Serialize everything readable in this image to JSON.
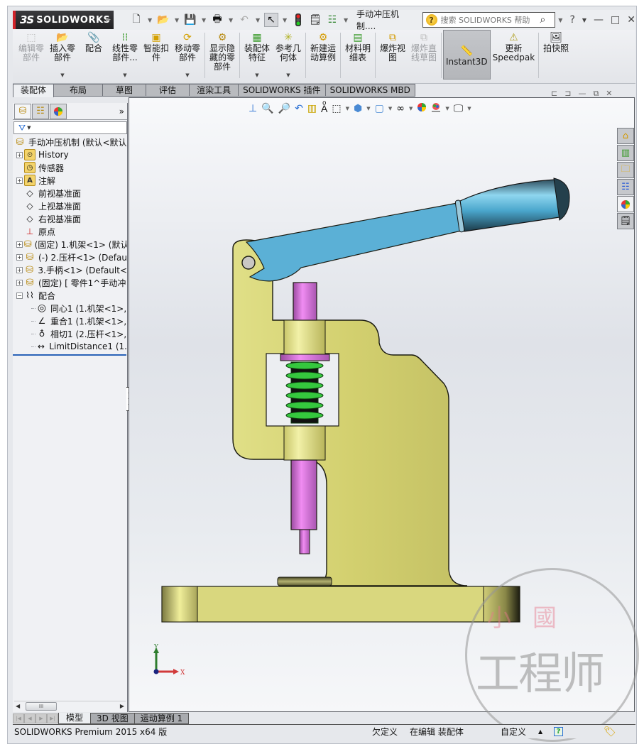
{
  "app": {
    "logo_prefix": "3S",
    "logo_text": "SOLIDWORKS",
    "document_title": "手动冲压机制....",
    "search_placeholder": "搜索 SOLIDWORKS 帮助",
    "help_glyph": "?",
    "window_controls": [
      "?",
      "—",
      "□",
      "✕"
    ]
  },
  "quick_access": [
    {
      "name": "new",
      "icon": "new-document-icon"
    },
    {
      "name": "open",
      "icon": "open-folder-icon"
    },
    {
      "name": "save",
      "icon": "save-icon"
    },
    {
      "name": "print",
      "icon": "print-icon"
    },
    {
      "name": "undo",
      "icon": "undo-icon"
    },
    {
      "name": "select",
      "icon": "select-pointer-icon"
    },
    {
      "name": "rebuild",
      "icon": "traffic-light-icon"
    },
    {
      "name": "file-properties",
      "icon": "file-properties-icon"
    },
    {
      "name": "options",
      "icon": "options-icon"
    }
  ],
  "ribbon": {
    "buttons": [
      {
        "label": "编辑零\n部件",
        "icon": "edit-component-icon",
        "disabled": true,
        "dropdown": false
      },
      {
        "label": "插入零\n部件",
        "icon": "insert-component-icon",
        "disabled": false,
        "dropdown": true
      },
      {
        "label": "配合",
        "icon": "mate-paperclip-icon",
        "disabled": false,
        "dropdown": false
      },
      {
        "label": "线性零\n部件...",
        "icon": "linear-pattern-icon",
        "disabled": false,
        "dropdown": true
      },
      {
        "label": "智能扣\n件",
        "icon": "smart-fastener-icon",
        "disabled": false,
        "dropdown": false
      },
      {
        "label": "移动零\n部件",
        "icon": "move-component-icon",
        "disabled": false,
        "dropdown": true
      },
      {
        "label": "显示隐\n藏的零\n部件",
        "icon": "show-hidden-icon",
        "disabled": false,
        "dropdown": false
      },
      {
        "label": "装配体\n特征",
        "icon": "assembly-feature-icon",
        "disabled": false,
        "dropdown": true
      },
      {
        "label": "参考几\n何体",
        "icon": "reference-geometry-icon",
        "disabled": false,
        "dropdown": true
      },
      {
        "label": "新建运\n动算例",
        "icon": "new-motion-study-icon",
        "disabled": false,
        "dropdown": false
      },
      {
        "label": "材料明\n细表",
        "icon": "bom-icon",
        "disabled": false,
        "dropdown": false
      },
      {
        "label": "爆炸视\n图",
        "icon": "exploded-view-icon",
        "disabled": false,
        "dropdown": false
      },
      {
        "label": "爆炸直\n线草图",
        "icon": "explode-line-sketch-icon",
        "disabled": true,
        "dropdown": false
      },
      {
        "label": "Instant3D",
        "icon": "instant3d-icon",
        "disabled": false,
        "dropdown": false,
        "active": true
      },
      {
        "label": "更新\nSpeedpak",
        "icon": "speedpak-icon",
        "disabled": false,
        "dropdown": false
      },
      {
        "label": "拍快照",
        "icon": "snapshot-icon",
        "disabled": false,
        "dropdown": false
      }
    ]
  },
  "command_tabs": [
    {
      "label": "装配体",
      "active": true
    },
    {
      "label": "布局"
    },
    {
      "label": "草图"
    },
    {
      "label": "评估"
    },
    {
      "label": "渲染工具"
    },
    {
      "label": "SOLIDWORKS 插件"
    },
    {
      "label": "SOLIDWORKS MBD"
    }
  ],
  "feature_manager": {
    "tabs": [
      "feature-manager-icon",
      "property-manager-icon",
      "appearance-manager-icon"
    ],
    "more": "»",
    "filter_icon": "▼",
    "tree": [
      {
        "level": 0,
        "expander": "",
        "icon": "assembly-icon",
        "label": "手动冲压机制  (默认<默认"
      },
      {
        "level": 1,
        "expander": "+",
        "icon": "history-icon",
        "label": "History"
      },
      {
        "level": 1,
        "expander": "",
        "icon": "sensor-icon",
        "label": "传感器"
      },
      {
        "level": 1,
        "expander": "+",
        "icon": "annotation-icon",
        "label": "注解"
      },
      {
        "level": 1,
        "expander": "",
        "icon": "plane-icon",
        "label": "前视基准面"
      },
      {
        "level": 1,
        "expander": "",
        "icon": "plane-icon",
        "label": "上视基准面"
      },
      {
        "level": 1,
        "expander": "",
        "icon": "plane-icon",
        "label": "右视基准面"
      },
      {
        "level": 1,
        "expander": "",
        "icon": "origin-icon",
        "label": "原点"
      },
      {
        "level": 1,
        "expander": "+",
        "icon": "part-icon",
        "label": "(固定) 1.机架<1> (默认"
      },
      {
        "level": 1,
        "expander": "+",
        "icon": "part-icon",
        "label": "(-) 2.压杆<1> (Defau"
      },
      {
        "level": 1,
        "expander": "+",
        "icon": "part-icon",
        "label": "3.手柄<1> (Default<"
      },
      {
        "level": 1,
        "expander": "+",
        "icon": "part-icon",
        "label": "(固定) [ 零件1^手动冲"
      },
      {
        "level": 1,
        "expander": "−",
        "icon": "mates-icon",
        "label": "配合"
      },
      {
        "level": 2,
        "expander": "",
        "icon": "concentric-icon",
        "label": "同心1 (1.机架<1>,"
      },
      {
        "level": 2,
        "expander": "",
        "icon": "coincident-icon",
        "label": "重合1 (1.机架<1>,"
      },
      {
        "level": 2,
        "expander": "",
        "icon": "tangent-icon",
        "label": "相切1 (2.压杆<1>,"
      },
      {
        "level": 2,
        "expander": "",
        "icon": "limit-distance-icon",
        "label": "LimitDistance1 (1."
      }
    ]
  },
  "view_toolbar": [
    "view-normal-icon",
    "zoom-to-fit-icon",
    "zoom-area-icon",
    "previous-view-icon",
    "section-view-icon",
    "dynamic-annotation-icon",
    "view-orientation-icon",
    "display-style-icon",
    "hide-show-items-icon",
    "edit-appearance-icon",
    "apply-scene-icon",
    "view-settings-icon"
  ],
  "viewport_controls": [
    "split-left-icon",
    "split-right-icon",
    "minimize-icon",
    "restore-icon",
    "close-icon"
  ],
  "task_pane": [
    {
      "icon": "solidworks-resources-icon"
    },
    {
      "icon": "design-library-icon"
    },
    {
      "icon": "file-explorer-icon"
    },
    {
      "icon": "view-palette-icon"
    },
    {
      "icon": "appearances-scenes-icon",
      "active": true
    },
    {
      "icon": "custom-properties-icon"
    }
  ],
  "triad": {
    "y_label": "Y",
    "x_label": "X"
  },
  "bottom_tabs": [
    {
      "label": "模型",
      "active": true
    },
    {
      "label": "3D 视图"
    },
    {
      "label": "运动算例 1"
    }
  ],
  "status": {
    "app_version": "SOLIDWORKS Premium 2015 x64 版",
    "definition": "欠定义",
    "mode": "在编辑 装配体",
    "units": "自定义",
    "up_arrow": "▲",
    "help": "?"
  },
  "watermark": {
    "top": "小國",
    "bottom": "工程师"
  },
  "colors": {
    "frame": "#d8d66f",
    "handle_arm": "#5eb1d6",
    "punch": "#e27ae6",
    "spring": "#2ec43a",
    "logo_accent": "#d2232a"
  }
}
